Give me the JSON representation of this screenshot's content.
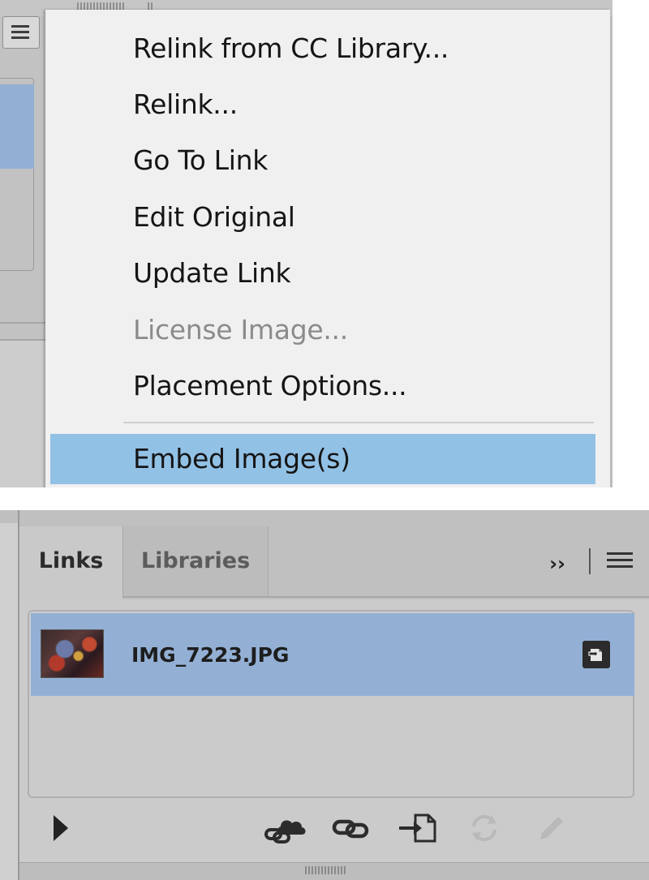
{
  "context_menu": {
    "items": [
      {
        "label": "Relink from CC Library...",
        "state": "enabled"
      },
      {
        "label": "Relink...",
        "state": "enabled"
      },
      {
        "label": "Go To Link",
        "state": "enabled"
      },
      {
        "label": "Edit Original",
        "state": "enabled"
      },
      {
        "label": "Update Link",
        "state": "enabled"
      },
      {
        "label": "License Image...",
        "state": "disabled"
      },
      {
        "label": "Placement Options...",
        "state": "enabled"
      },
      {
        "label": "Embed Image(s)",
        "state": "highlighted"
      }
    ]
  },
  "links_panel": {
    "tabs": [
      {
        "label": "Links",
        "active": true
      },
      {
        "label": "Libraries",
        "active": false
      }
    ],
    "overflow_label": "››",
    "links": [
      {
        "name": "IMG_7223.JPG",
        "selected": true,
        "thumbnail_icon": "image-thumbnail",
        "status_icon": "embed-link-icon"
      }
    ],
    "toolbar": [
      {
        "icon": "show-info-triangle-icon",
        "enabled": true
      },
      {
        "icon": "relink-from-cc-library-icon",
        "enabled": true
      },
      {
        "icon": "relink-icon",
        "enabled": true
      },
      {
        "icon": "go-to-link-icon",
        "enabled": true
      },
      {
        "icon": "update-link-icon",
        "enabled": false
      },
      {
        "icon": "edit-original-icon",
        "enabled": false
      }
    ]
  },
  "colors": {
    "menu_background": "#f0f0f0",
    "menu_highlight": "#92c1e6",
    "selected_row": "#93b0d4",
    "panel_background": "#cbcbcb",
    "disabled_text": "#8b8b8b"
  }
}
